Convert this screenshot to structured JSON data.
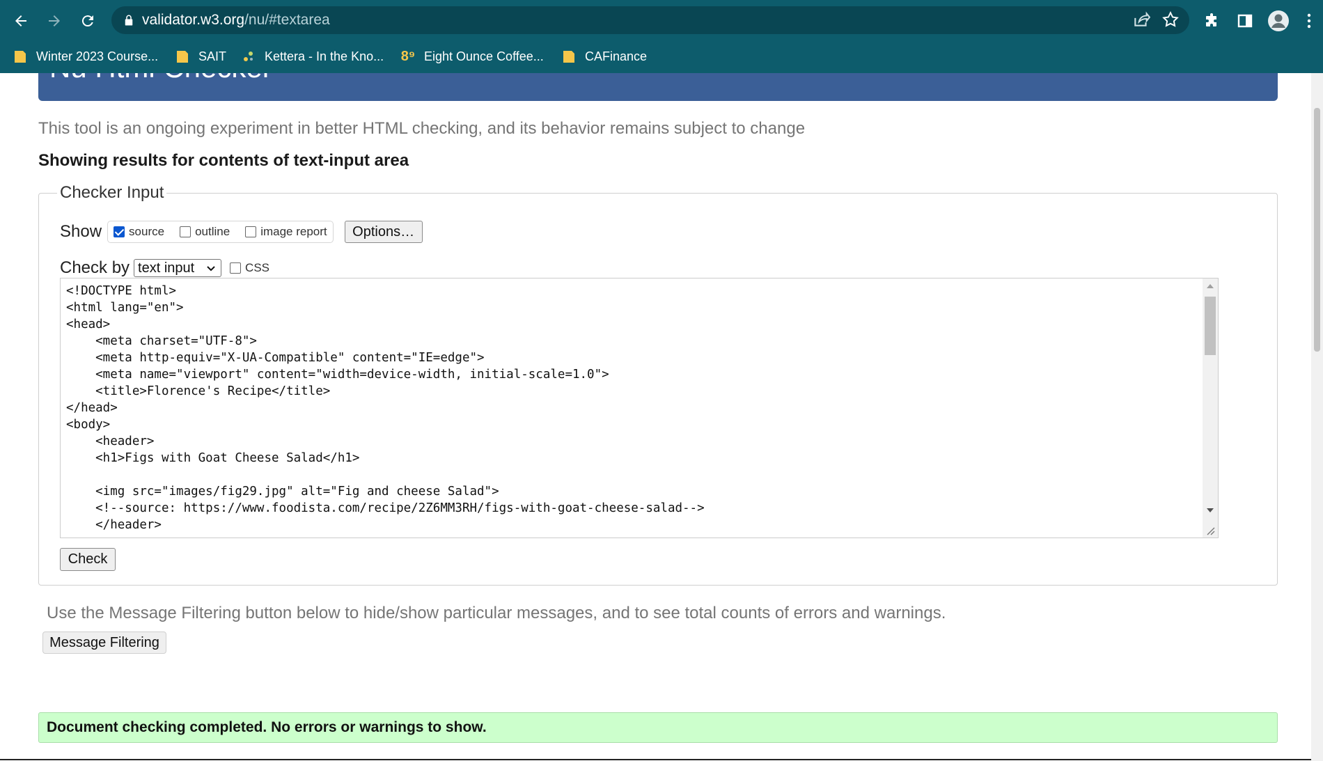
{
  "browser": {
    "url_host": "validator.w3.org",
    "url_path": "/nu/#textarea",
    "bookmarks": [
      {
        "label": "Winter 2023 Course...",
        "icon": "folder-icon"
      },
      {
        "label": "SAIT",
        "icon": "folder-icon"
      },
      {
        "label": "Kettera - In the Kno...",
        "icon": "kettera-favicon"
      },
      {
        "label": "Eight Ounce Coffee...",
        "icon": "eight-ounce-favicon"
      },
      {
        "label": "CAFinance",
        "icon": "folder-icon"
      }
    ],
    "colors": {
      "chrome": "#0d5c6c",
      "omnibox": "#094653"
    }
  },
  "page": {
    "title": "Nu Html Checker",
    "tagline": "This tool is an ongoing experiment in better HTML checking, and its behavior remains subject to change",
    "results_heading": "Showing results for contents of text-input area",
    "checker_input": {
      "legend": "Checker Input",
      "show_label": "Show",
      "options": [
        {
          "label": "source",
          "checked": true
        },
        {
          "label": "outline",
          "checked": false
        },
        {
          "label": "image report",
          "checked": false
        }
      ],
      "options_button": "Options…",
      "check_by_label": "Check by",
      "check_by_value": "text input",
      "css_label": "CSS",
      "css_checked": false,
      "source_code": "<!DOCTYPE html>\n<html lang=\"en\">\n<head>\n    <meta charset=\"UTF-8\">\n    <meta http-equiv=\"X-UA-Compatible\" content=\"IE=edge\">\n    <meta name=\"viewport\" content=\"width=device-width, initial-scale=1.0\">\n    <title>Florence's Recipe</title>\n</head>\n<body>\n    <header>\n    <h1>Figs with Goat Cheese Salad</h1>\n\n    <img src=\"images/fig29.jpg\" alt=\"Fig and cheese Salad\">\n    <!--source: https://www.foodista.com/recipe/2Z6MM3RH/figs-with-goat-cheese-salad-->\n    </header>",
      "check_button": "Check"
    },
    "filter_text": "Use the Message Filtering button below to hide/show particular messages, and to see total counts of errors and warnings.",
    "filter_button": "Message Filtering",
    "success_message": "Document checking completed. No errors or warnings to show.",
    "colors": {
      "title_bar": "#3b5f97",
      "success_bg": "#ccffcc"
    }
  }
}
